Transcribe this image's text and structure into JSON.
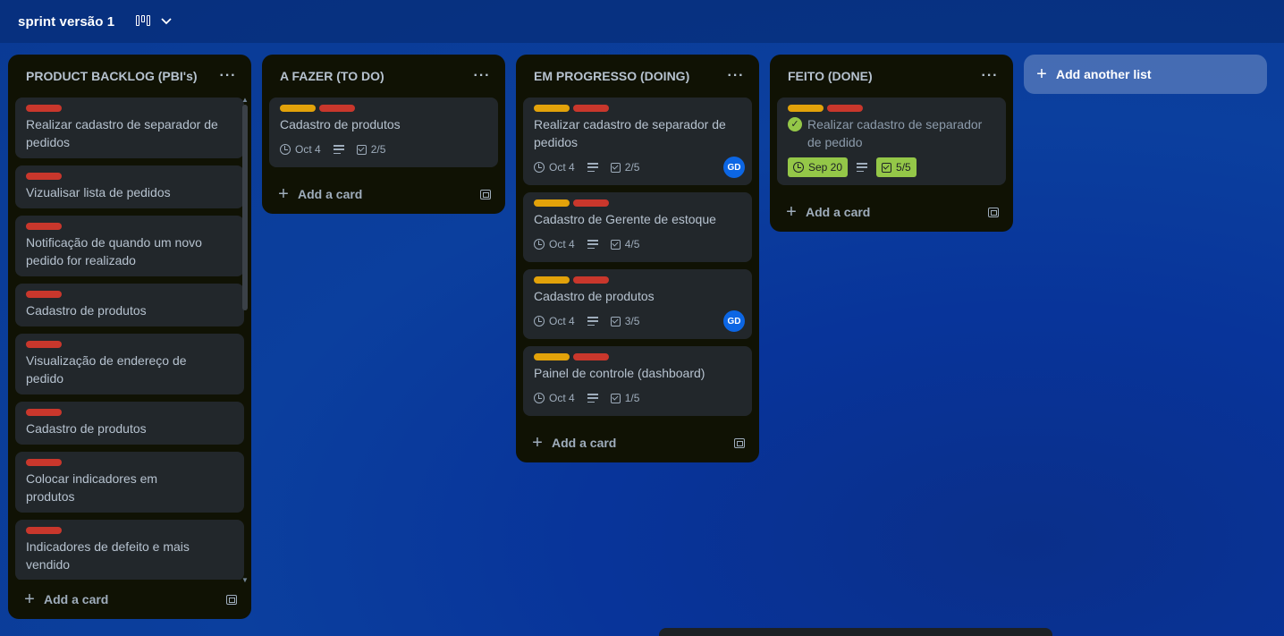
{
  "board": {
    "title": "sprint versão 1"
  },
  "lists": [
    {
      "title": "PRODUCT BACKLOG (PBI's)",
      "menu": "···",
      "add_card": "Add a card",
      "cards": [
        {
          "labels": [
            "red"
          ],
          "title": "Realizar cadastro de separador de pedidos"
        },
        {
          "labels": [
            "red"
          ],
          "title": "Vizualisar lista de pedidos"
        },
        {
          "labels": [
            "red"
          ],
          "title": "Notificação de quando um novo pedido for realizado"
        },
        {
          "labels": [
            "red"
          ],
          "title": "Cadastro de produtos"
        },
        {
          "labels": [
            "red"
          ],
          "title": "Visualização de endereço de pedido"
        },
        {
          "labels": [
            "red"
          ],
          "title": "Cadastro de produtos"
        },
        {
          "labels": [
            "red"
          ],
          "title": "Colocar indicadores em produtos"
        },
        {
          "labels": [
            "red"
          ],
          "title": "Indicadores de defeito e mais vendido"
        }
      ]
    },
    {
      "title": "A FAZER (TO DO)",
      "menu": "···",
      "add_card": "Add a card",
      "cards": [
        {
          "labels": [
            "yellow",
            "red"
          ],
          "title": "Cadastro de produtos",
          "due": "Oct 4",
          "checklist": "2/5"
        }
      ]
    },
    {
      "title": "EM PROGRESSO (DOING)",
      "menu": "···",
      "add_card": "Add a card",
      "cards": [
        {
          "labels": [
            "yellow",
            "red"
          ],
          "title": "Realizar cadastro de separador de pedidos",
          "due": "Oct 4",
          "checklist": "2/5",
          "member": "GD"
        },
        {
          "labels": [
            "yellow",
            "red"
          ],
          "title": "Cadastro de Gerente de estoque",
          "due": "Oct 4",
          "checklist": "4/5"
        },
        {
          "labels": [
            "yellow",
            "red"
          ],
          "title": "Cadastro de produtos",
          "due": "Oct 4",
          "checklist": "3/5",
          "member": "GD"
        },
        {
          "labels": [
            "yellow",
            "red"
          ],
          "title": "Painel de controle (dashboard)",
          "due": "Oct 4",
          "checklist": "1/5"
        }
      ]
    },
    {
      "title": "FEITO (DONE)",
      "menu": "···",
      "add_card": "Add a card",
      "cards": [
        {
          "labels": [
            "yellow",
            "red"
          ],
          "title": "Realizar cadastro de separador de pedido",
          "due": "Sep 20",
          "checklist": "5/5",
          "complete": true
        }
      ]
    }
  ],
  "add_list": "Add another list",
  "colors": {
    "yellow": "#e2a20a",
    "red": "#c9372c",
    "complete": "#94c748",
    "member": "#0c66e4"
  }
}
